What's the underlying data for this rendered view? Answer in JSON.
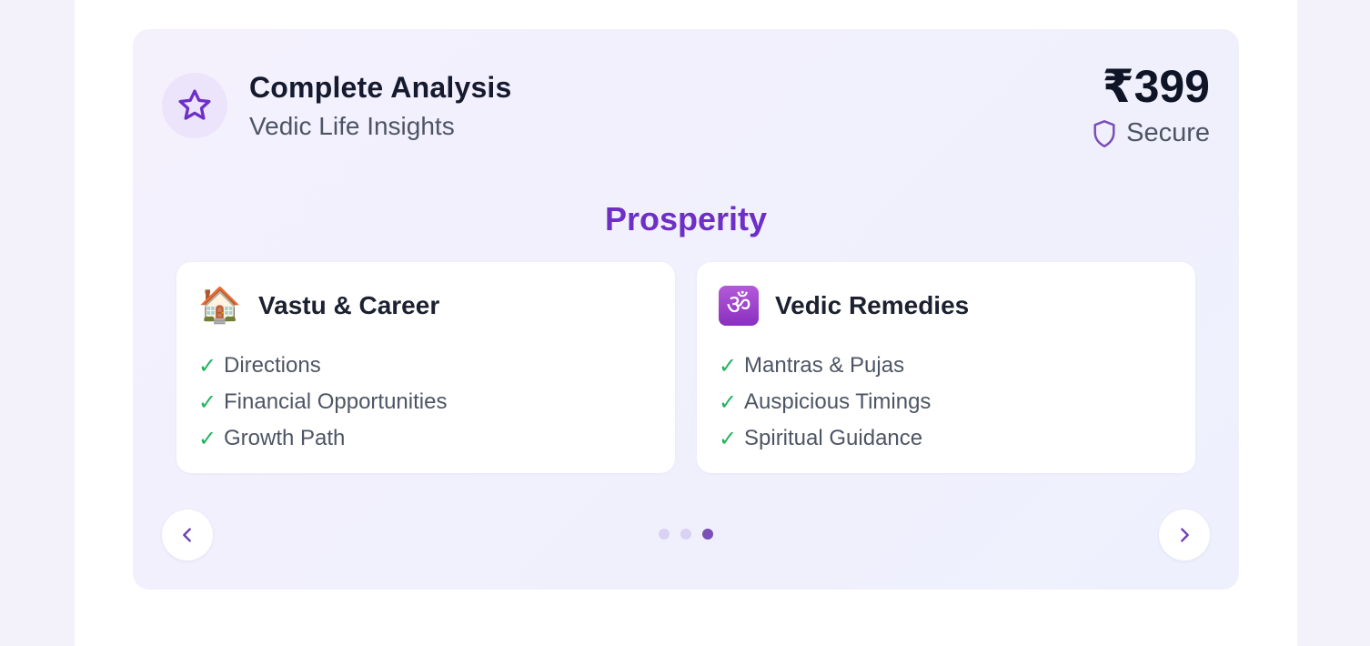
{
  "plan": {
    "title": "Complete Analysis",
    "subtitle": "Vedic Life Insights",
    "price": "₹399",
    "secure_label": "Secure"
  },
  "section": {
    "title": "Prosperity"
  },
  "features": [
    {
      "icon": "house-emoji",
      "icon_glyph": "🏠",
      "title": "Vastu & Career",
      "items": [
        "Directions",
        "Financial Opportunities",
        "Growth Path"
      ]
    },
    {
      "icon": "om-emoji",
      "icon_glyph": "ॐ",
      "title": "Vedic Remedies",
      "items": [
        "Mantras & Pujas",
        "Auspicious Timings",
        "Spiritual Guidance"
      ]
    }
  ],
  "carousel": {
    "slide_count": 3,
    "active_index": 2
  },
  "colors": {
    "accent": "#6d2fc6",
    "check": "#22b35e",
    "dot_active": "#7a4fb8",
    "dot_inactive": "#d9d2f2"
  }
}
